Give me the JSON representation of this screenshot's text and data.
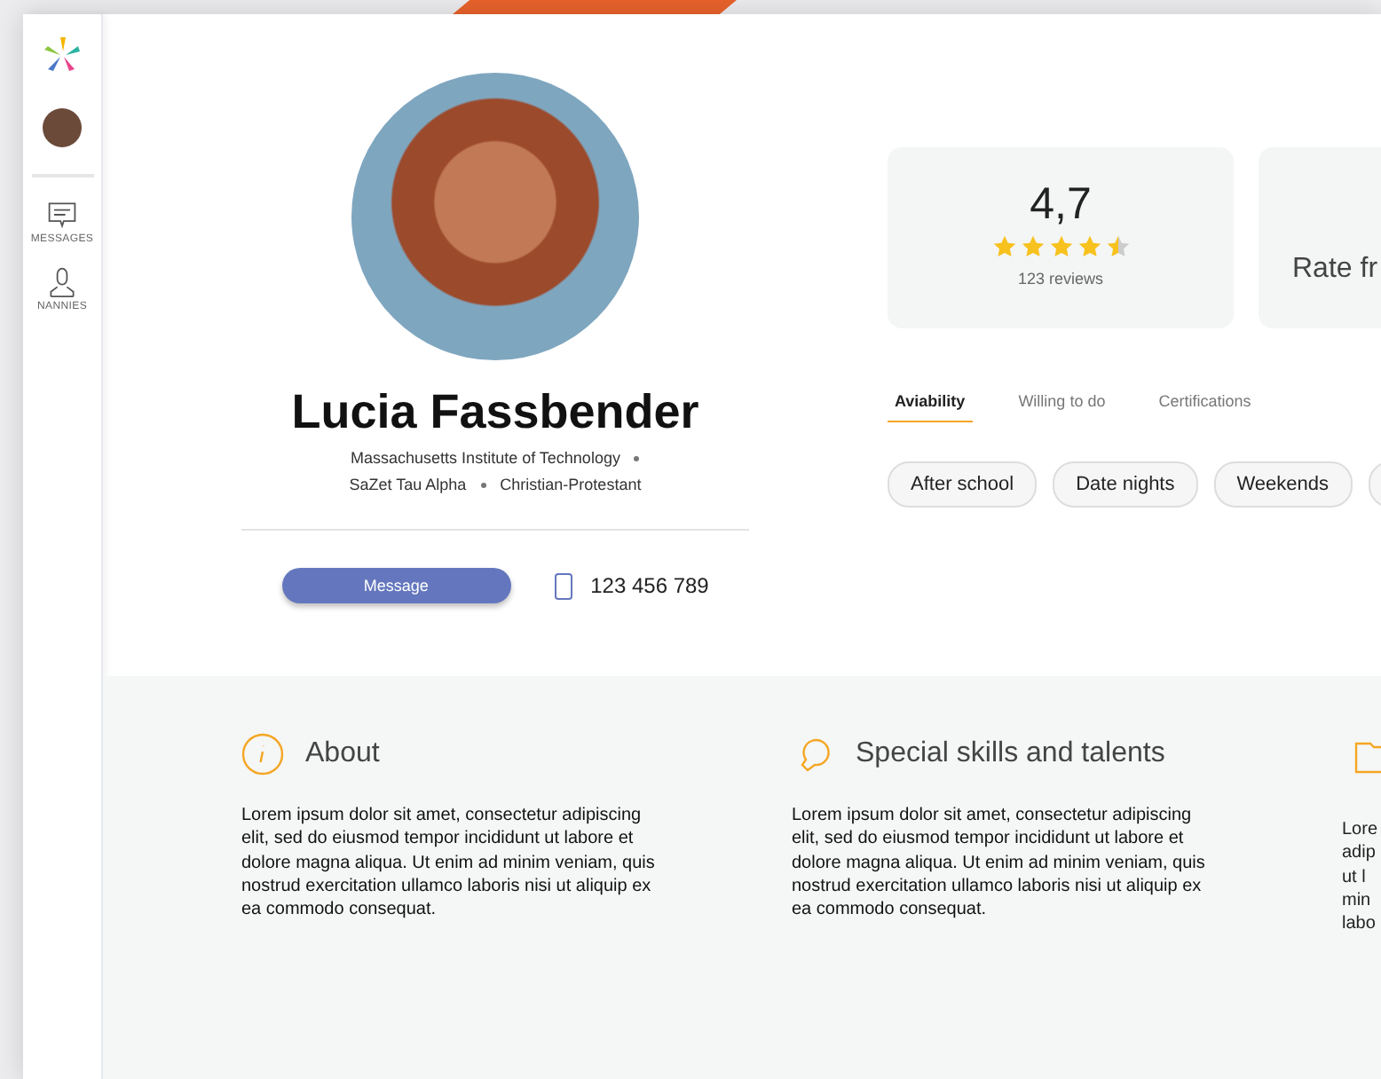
{
  "sidebar": {
    "items": [
      {
        "kind": "messages",
        "label": "MESSAGES"
      },
      {
        "kind": "nannies",
        "label": "NANNIES"
      }
    ]
  },
  "profile": {
    "name": "Lucia Fassbender",
    "detail_lines": [
      [
        "Massachusetts Institute of Technology"
      ],
      [
        "SaZet Tau Alpha",
        "Christian-Protestant"
      ]
    ],
    "message_button": "Message",
    "phone": "123 456 789"
  },
  "rating": {
    "score": "4,7",
    "stars": 4.5,
    "reviews": "123 reviews"
  },
  "rate_card": {
    "text": "Rate fr"
  },
  "tabs": [
    {
      "label": "Aviability",
      "selected": true
    },
    {
      "label": "Willing to do",
      "selected": false
    },
    {
      "label": "Certifications",
      "selected": false
    }
  ],
  "chips": [
    "After school",
    "Date nights",
    "Weekends"
  ],
  "sections": [
    {
      "kind": "about",
      "title": "About",
      "text": "Lorem ipsum dolor sit amet, consectetur adipiscing elit, sed do eiusmod tempor incididunt ut labore et dolore magna aliqua. Ut enim ad minim veniam, quis nostrud exercitation ullamco laboris nisi ut aliquip ex ea commodo consequat."
    },
    {
      "kind": "skills",
      "title": "Special skills and talents",
      "text": "Lorem ipsum dolor sit amet, consectetur adipiscing elit, sed do eiusmod tempor incididunt ut labore et dolore magna aliqua. Ut enim ad minim veniam, quis nostrud exercitation ullamco laboris nisi ut aliquip ex ea commodo consequat."
    },
    {
      "kind": "cut",
      "lines": [
        "Lore",
        "adip",
        "ut l",
        "min",
        "labo"
      ]
    }
  ]
}
